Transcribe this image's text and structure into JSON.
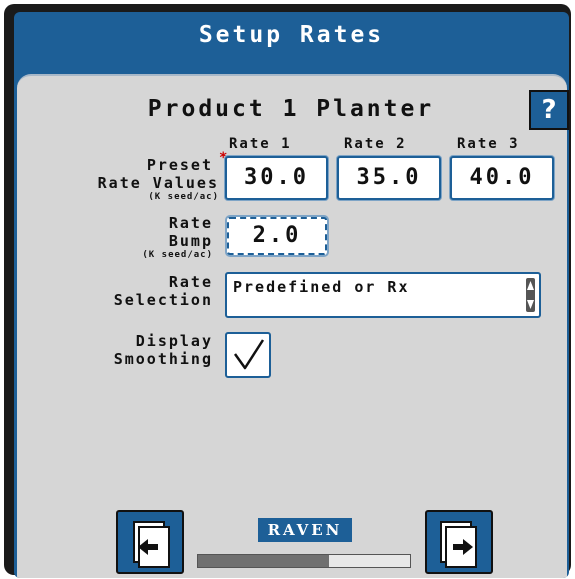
{
  "header": {
    "title": "Setup Rates"
  },
  "panel": {
    "product_title": "Product 1 Planter",
    "help_label": "?",
    "preset": {
      "label_line1": "Preset",
      "required_mark": "*",
      "label_line2": "Rate Values",
      "unit": "(K seed/ac)",
      "column_headers": [
        "Rate 1",
        "Rate 2",
        "Rate 3"
      ],
      "values": [
        "30.0",
        "35.0",
        "40.0"
      ]
    },
    "rate_bump": {
      "label_line1": "Rate",
      "label_line2": "Bump",
      "unit": "(K seed/ac)",
      "value": "2.0"
    },
    "rate_selection": {
      "label_line1": "Rate",
      "label_line2": "Selection",
      "value": "Predefined or Rx"
    },
    "display_smoothing": {
      "label_line1": "Display",
      "label_line2": "Smoothing",
      "checked": true
    }
  },
  "footer": {
    "brand": "RAVEN",
    "progress_fraction": 0.62
  },
  "colors": {
    "accent": "#1d5f97",
    "panel": "#d6d6d6",
    "required": "#cc0000"
  },
  "icons": {
    "back": "back-arrow-icon",
    "forward": "forward-arrow-icon",
    "help": "help-icon",
    "check": "checkmark-icon"
  }
}
